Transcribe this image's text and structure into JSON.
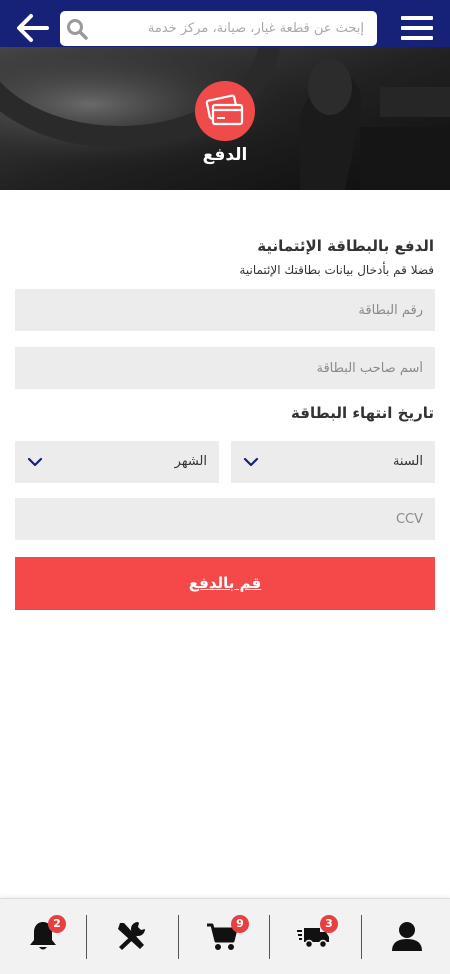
{
  "header": {
    "search_placeholder": "إبحث عن قطعة غيار، صيانة، مركز خدمة",
    "bg_color": "#162277"
  },
  "hero": {
    "title": "الدفع",
    "icon": "credit-cards-icon",
    "accent": "#f04b4b"
  },
  "form": {
    "title": "الدفع بالبطاقة الإئتمانية",
    "subtitle": "فضلا قم بأدخال بيانات بطاقتك الإئتمانية",
    "card_number_placeholder": "رقم البطاقة",
    "card_holder_placeholder": "أسم صاحب البطاقة",
    "expiry_label": "تاريخ انتهاء البطاقة",
    "year_select": "السنة",
    "month_select": "الشهر",
    "ccv_placeholder": "CCV",
    "pay_button": "قم بالدفع",
    "button_color": "#f54848"
  },
  "bottom_nav": {
    "items": [
      {
        "name": "notifications",
        "icon": "bell-icon",
        "badge": "2"
      },
      {
        "name": "maintenance",
        "icon": "tools-icon",
        "badge": ""
      },
      {
        "name": "cart",
        "icon": "cart-icon",
        "badge": "9"
      },
      {
        "name": "delivery",
        "icon": "delivery-truck-icon",
        "badge": "3"
      },
      {
        "name": "profile",
        "icon": "user-icon",
        "badge": ""
      }
    ]
  }
}
